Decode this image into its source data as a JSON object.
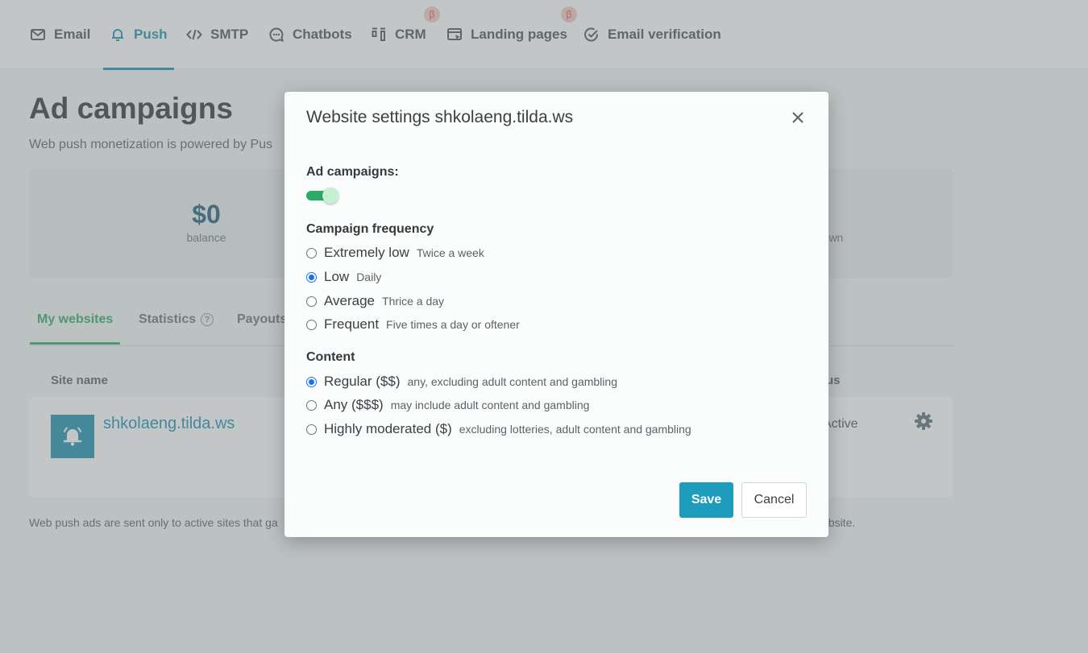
{
  "nav": {
    "items": [
      {
        "label": "Email",
        "icon": "envelope-icon"
      },
      {
        "label": "Push",
        "icon": "bell-icon",
        "active": true
      },
      {
        "label": "SMTP",
        "icon": "code-icon"
      },
      {
        "label": "Chatbots",
        "icon": "chat-bubble-icon"
      },
      {
        "label": "CRM",
        "icon": "kanban-icon",
        "beta": "β"
      },
      {
        "label": "Landing pages",
        "icon": "landing-page-icon",
        "beta": "β"
      },
      {
        "label": "Email verification",
        "icon": "check-circle-icon"
      }
    ]
  },
  "page": {
    "title": "Ad campaigns",
    "subtitle": "Web push monetization is powered by Pus",
    "balance_value": "$0",
    "balance_label": "balance",
    "withdrawn_label": "rawn",
    "tabs": [
      "My websites",
      "Statistics",
      "Payouts"
    ],
    "help_glyph": "?",
    "columns": {
      "site": "Site name",
      "status": "tus"
    },
    "site": {
      "name": "shkolaeng.tilda.ws",
      "status": "Active",
      "icon": "bell-icon"
    },
    "footer_note": "Web push ads are sent only to active sites that ga",
    "footer_note_end": "ebsite."
  },
  "modal": {
    "title": "Website settings shkolaeng.tilda.ws",
    "ad_campaigns_label": "Ad campaigns:",
    "ad_campaigns_enabled": true,
    "frequency_label": "Campaign frequency",
    "frequency_options": [
      {
        "label": "Extremely low",
        "desc": "Twice a week",
        "checked": false
      },
      {
        "label": "Low",
        "desc": "Daily",
        "checked": true
      },
      {
        "label": "Average",
        "desc": "Thrice a day",
        "checked": false
      },
      {
        "label": "Frequent",
        "desc": "Five times a day or oftener",
        "checked": false
      }
    ],
    "content_label": "Content",
    "content_options": [
      {
        "label": "Regular ($$)",
        "desc": "any, excluding adult content and gambling",
        "checked": true
      },
      {
        "label": "Any ($$$)",
        "desc": "may include adult content and gambling",
        "checked": false
      },
      {
        "label": "Highly moderated ($)",
        "desc": "excluding lotteries, adult content and gambling",
        "checked": false
      }
    ],
    "save_label": "Save",
    "cancel_label": "Cancel"
  },
  "colors": {
    "accent": "#1d8eab",
    "green": "#2bab63",
    "save_button": "#1d9cbd",
    "radio_checked": "#1a73e8"
  }
}
